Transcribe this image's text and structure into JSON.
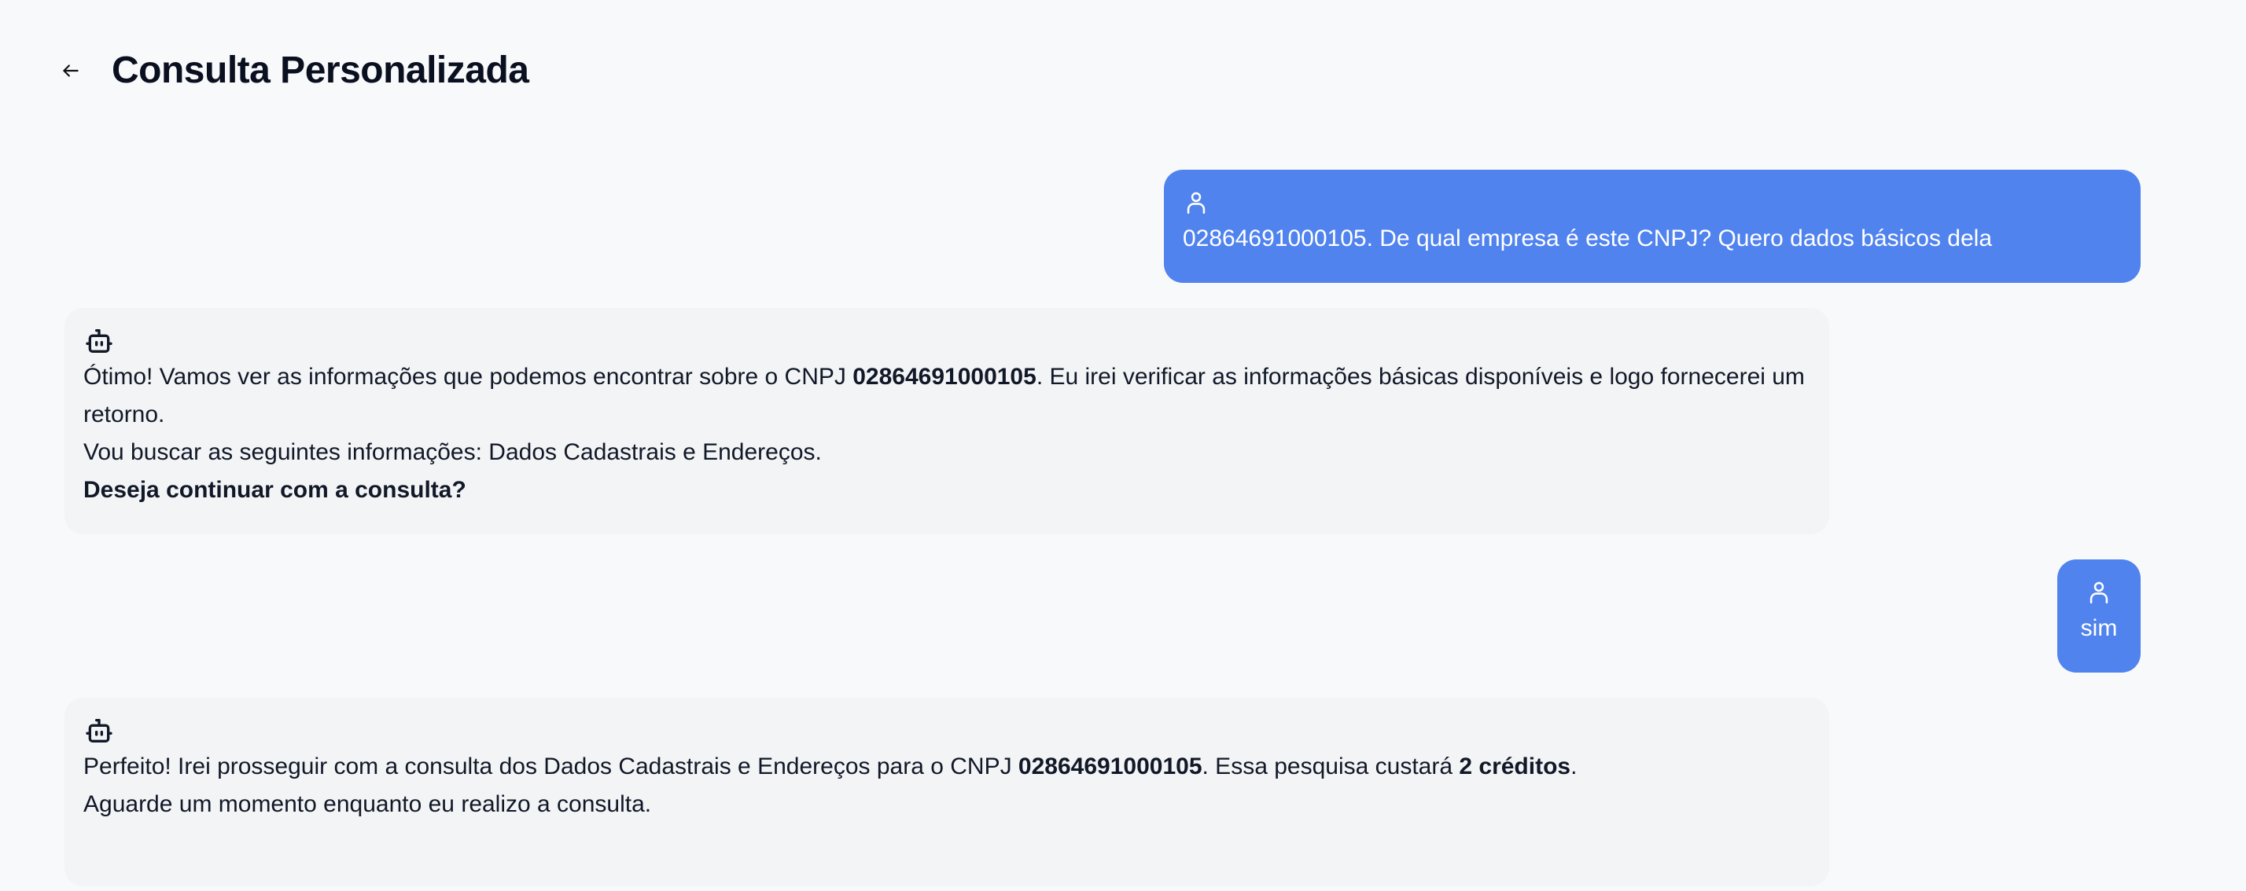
{
  "header": {
    "title": "Consulta Personalizada",
    "back_icon": "arrow-left-icon"
  },
  "colors": {
    "user_bubble": "#5083ee",
    "bot_bubble": "#f3f4f6",
    "background": "#f8f9fb"
  },
  "messages": [
    {
      "role": "user",
      "icon": "user-icon",
      "text": "02864691000105. De qual empresa é este CNPJ? Quero dados básicos dela"
    },
    {
      "role": "bot",
      "icon": "robot-icon",
      "l1a": "Ótimo! Vamos ver as informações que podemos encontrar sobre o CNPJ ",
      "l1b": "02864691000105",
      "l1c": ". Eu irei verificar as informações básicas disponíveis e logo fornecerei um retorno.",
      "l2": "Vou buscar as seguintes informações: Dados Cadastrais e Endereços.",
      "l3": "Deseja continuar com a consulta?"
    },
    {
      "role": "user",
      "icon": "user-icon",
      "text": "sim"
    },
    {
      "role": "bot",
      "icon": "robot-icon",
      "l1a": "Perfeito! Irei prosseguir com a consulta dos Dados Cadastrais e Endereços para o CNPJ ",
      "l1b": "02864691000105",
      "l1c": ". Essa pesquisa custará ",
      "l1d": "2 créditos",
      "l1e": ".",
      "l2": "Aguarde um momento enquanto eu realizo a consulta."
    }
  ]
}
